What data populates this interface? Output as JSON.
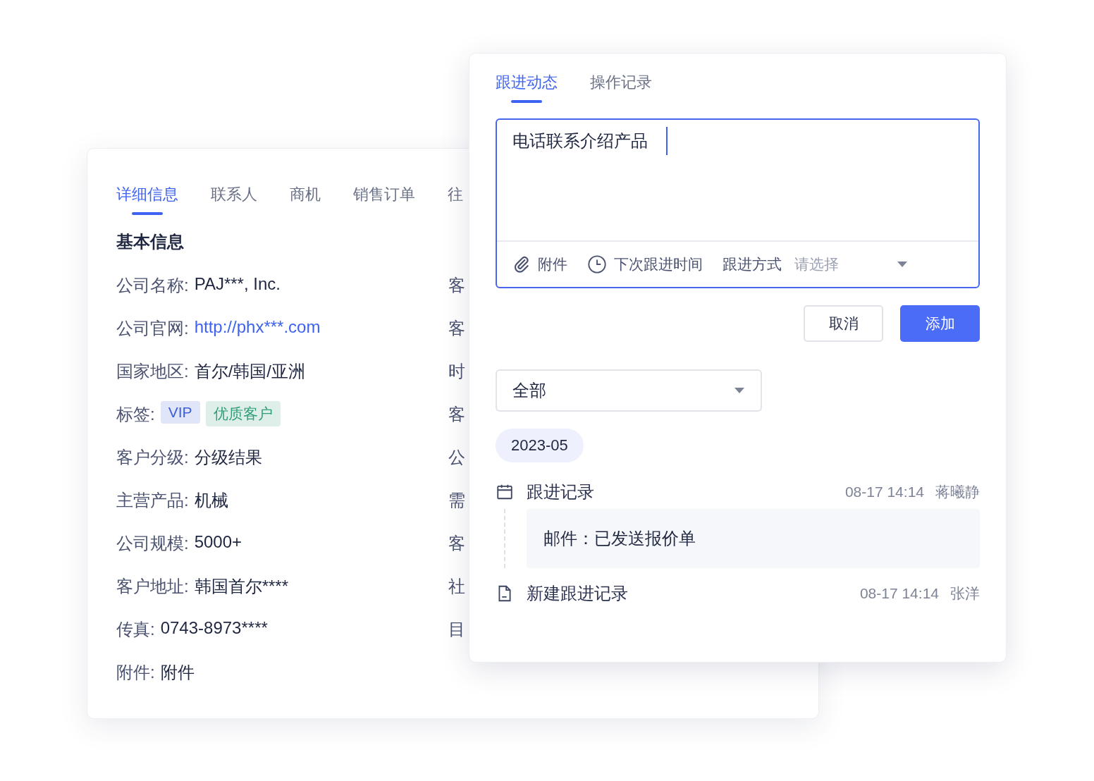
{
  "detail_panel": {
    "tabs": [
      {
        "label": "详细信息",
        "selected": true
      },
      {
        "label": "联系人",
        "selected": false
      },
      {
        "label": "商机",
        "selected": false
      },
      {
        "label": "销售订单",
        "selected": false
      },
      {
        "label": "往",
        "selected": false
      }
    ],
    "section_title": "基本信息",
    "fields": [
      {
        "kind": "text",
        "label": "公司名称:",
        "value": "PAJ***, Inc."
      },
      {
        "kind": "link",
        "label": "公司官网:",
        "value": "http://phx***.com"
      },
      {
        "kind": "text",
        "label": "国家地区:",
        "value": "首尔/韩国/亚洲"
      },
      {
        "kind": "tags",
        "label": "标签:",
        "tags": [
          {
            "label": "VIP",
            "color": "#3d5fd6"
          },
          {
            "label": "优质客户",
            "color": "#2f9c7a"
          }
        ]
      },
      {
        "kind": "text",
        "label": "客户分级:",
        "value": "分级结果"
      },
      {
        "kind": "text",
        "label": "主营产品:",
        "value": "机械"
      },
      {
        "kind": "text",
        "label": "公司规模:",
        "value": "5000+"
      },
      {
        "kind": "text",
        "label": "客户地址:",
        "value": "韩国首尔****"
      },
      {
        "kind": "text",
        "label": "传真:",
        "value": "0743-8973****"
      },
      {
        "kind": "text",
        "label": "附件:",
        "value": "附件"
      }
    ],
    "column_2_labels": [
      "客",
      "客",
      "时",
      "客",
      "公",
      "需",
      "客",
      "社",
      "目"
    ]
  },
  "follow_panel": {
    "tabs": [
      {
        "label": "跟进动态",
        "selected": true
      },
      {
        "label": "操作记录",
        "selected": false
      }
    ],
    "editor": {
      "value": "电话联系介绍产品",
      "attachment": "附件",
      "next_time": "下次跟进时间",
      "method_label": "跟进方式",
      "method_placeholder": "请选择"
    },
    "buttons": [
      {
        "label": "取消",
        "kind": "secondary"
      },
      {
        "label": "添加",
        "kind": "primary"
      }
    ],
    "filter": {
      "value": "全部"
    },
    "month": "2023-05",
    "timeline": [
      {
        "kind": "calendar",
        "title": "跟进记录",
        "time": "08-17 14:14",
        "user": "蒋曦静",
        "content": "邮件：已发送报价单"
      },
      {
        "kind": "document",
        "title": "新建跟进记录",
        "time": "08-17 14:14",
        "user": "张洋"
      }
    ]
  }
}
